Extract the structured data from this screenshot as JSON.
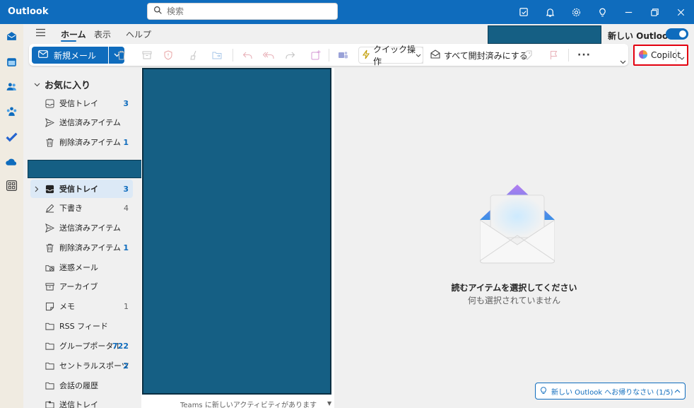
{
  "titlebar": {
    "app_title": "Outlook",
    "search_placeholder": "検索"
  },
  "menu": {
    "tabs": [
      {
        "label": "ホーム",
        "active": true
      },
      {
        "label": "表示",
        "active": false
      },
      {
        "label": "ヘルプ",
        "active": false
      }
    ],
    "new_outlook_label": "新しい Outlook",
    "new_outlook_on": true
  },
  "ribbon": {
    "new_mail_label": "新規メール",
    "quick_steps_label": "クイック操作",
    "mark_all_read_label": "すべて開封済みにする",
    "more_label": "···",
    "copilot_label": "Copilot"
  },
  "folders": {
    "favorites_label": "お気に入り",
    "favorites": [
      {
        "label": "受信トレイ",
        "icon": "inbox-icon",
        "count": "3"
      },
      {
        "label": "送信済みアイテム",
        "icon": "send-icon",
        "count": ""
      },
      {
        "label": "削除済みアイテム",
        "icon": "trash-icon",
        "count": "1"
      }
    ],
    "account": [
      {
        "label": "受信トレイ",
        "icon": "inbox-filled-icon",
        "count": "3",
        "selected": true
      },
      {
        "label": "下書き",
        "icon": "draft-icon",
        "count": "4",
        "count_gray": true
      },
      {
        "label": "送信済みアイテム",
        "icon": "send-icon",
        "count": ""
      },
      {
        "label": "削除済みアイテム",
        "icon": "trash-icon",
        "count": "1"
      },
      {
        "label": "迷惑メール",
        "icon": "junk-icon",
        "count": ""
      },
      {
        "label": "アーカイブ",
        "icon": "archive-icon",
        "count": ""
      },
      {
        "label": "メモ",
        "icon": "note-icon",
        "count": "1",
        "count_gray": true
      },
      {
        "label": "RSS フィード",
        "icon": "folder-icon",
        "count": ""
      },
      {
        "label": "グループポータル",
        "icon": "folder-icon",
        "count": "722"
      },
      {
        "label": "セントラルスポーツ",
        "icon": "folder-icon",
        "count": "2"
      },
      {
        "label": "会話の履歴",
        "icon": "folder-icon",
        "count": ""
      },
      {
        "label": "送信トレイ",
        "icon": "outbox-icon",
        "count": ""
      }
    ]
  },
  "message_list": {
    "peek_text": "Teams に新しいアクティビティがあります"
  },
  "reading_pane": {
    "empty_title": "読むアイテムを選択してください",
    "empty_subtitle": "何も選択されていません",
    "banner_text": "新しい Outlook へお帰りなさい (1/5)"
  },
  "colors": {
    "brand": "#0f6cbd",
    "redaction": "#155f84",
    "highlight": "#e3000f"
  }
}
